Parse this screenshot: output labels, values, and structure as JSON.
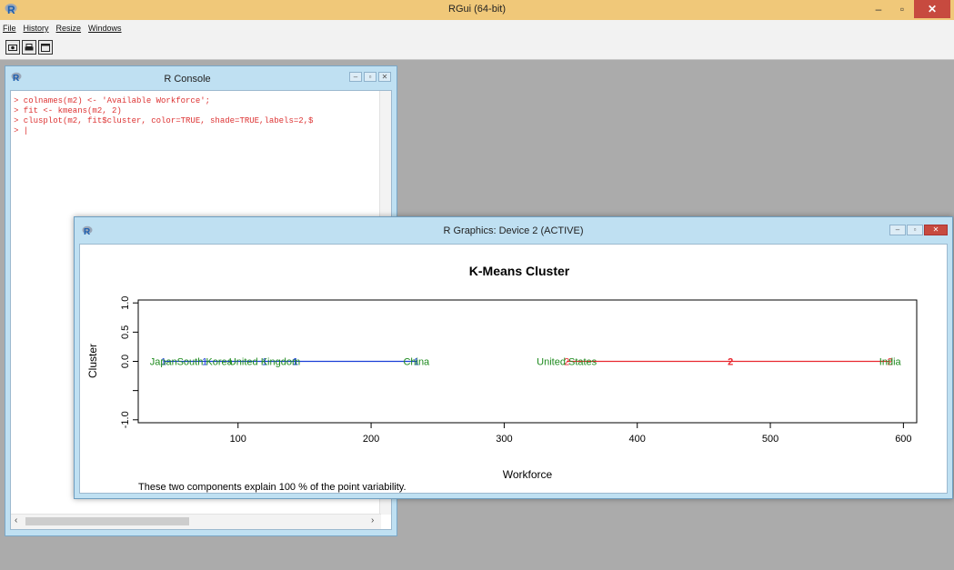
{
  "app": {
    "title": "RGui (64-bit)",
    "menu": [
      "File",
      "History",
      "Resize",
      "Windows"
    ],
    "controls": {
      "minimize": "–",
      "restore": "▫",
      "close": "✕"
    }
  },
  "toolbar": {
    "icons": [
      "camera-icon",
      "print-icon",
      "window-icon"
    ]
  },
  "console": {
    "title": "R Console",
    "lines": [
      "> colnames(m2) <- 'Available Workforce';",
      "> fit <- kmeans(m2, 2)",
      "> clusplot(m2, fit$cluster, color=TRUE, shade=TRUE,labels=2,$",
      "> |"
    ],
    "scroll_left": "‹",
    "scroll_right": "›"
  },
  "graphics": {
    "title": "R Graphics: Device 2 (ACTIVE)"
  },
  "chart_data": {
    "type": "scatter",
    "title": "K-Means Cluster",
    "xlabel": "Workforce",
    "ylabel": "Cluster",
    "xlim": [
      25,
      610
    ],
    "ylim": [
      -1.05,
      1.05
    ],
    "xticks": [
      100,
      200,
      300,
      400,
      500,
      600
    ],
    "yticks": [
      1.0,
      0.5,
      0.0,
      -0.5,
      -1.0
    ],
    "ytick_labels": [
      "1.0",
      "0.5",
      "0.0",
      "",
      "-1.0"
    ],
    "footnote": "These two components explain 100 % of the point variability.",
    "points": [
      {
        "label": "Japan",
        "x": 44,
        "y": 0,
        "cluster": 1
      },
      {
        "label": "South Korea",
        "x": 75,
        "y": 0,
        "cluster": 1
      },
      {
        "label": "United Kingdom",
        "x": 120,
        "y": 0,
        "cluster": 1
      },
      {
        "label": "China",
        "x": 234,
        "y": 0,
        "cluster": 1
      },
      {
        "label": "United States",
        "x": 347,
        "y": 0,
        "cluster": 2
      },
      {
        "label": "India",
        "x": 590,
        "y": 0,
        "cluster": 2
      }
    ],
    "clusters": [
      {
        "id": 1,
        "label": "1",
        "center": 143,
        "range": [
          44,
          234
        ],
        "color": "#1a3fd6"
      },
      {
        "id": 2,
        "label": "2",
        "center": 470,
        "range": [
          347,
          590
        ],
        "color": "#e8272f"
      }
    ],
    "label_color": "#1e8a1e"
  }
}
